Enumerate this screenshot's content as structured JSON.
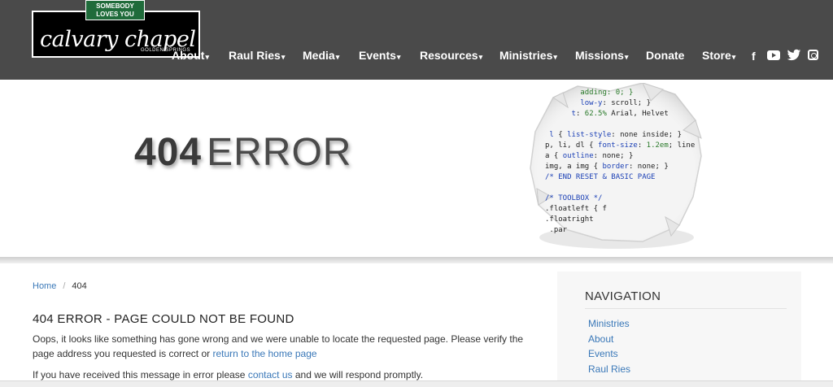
{
  "header": {
    "logo": {
      "tagline": "SOMEBODY LOVES YOU",
      "name": "calvary chapel",
      "sub": "GOLDEN SPRINGS"
    },
    "nav": [
      {
        "label": "About",
        "dropdown": true
      },
      {
        "label": "Raul Ries",
        "dropdown": true
      },
      {
        "label": "Media",
        "dropdown": true
      },
      {
        "label": "Events",
        "dropdown": true
      },
      {
        "label": "Resources",
        "dropdown": true
      },
      {
        "label": "Ministries",
        "dropdown": true
      },
      {
        "label": "Missions",
        "dropdown": true
      },
      {
        "label": "Donate",
        "dropdown": false
      },
      {
        "label": "Store",
        "dropdown": true
      }
    ],
    "social": [
      "facebook-icon",
      "youtube-icon",
      "twitter-icon",
      "instagram-icon"
    ]
  },
  "hero": {
    "title_num": "404",
    "title_word": "ERROR"
  },
  "breadcrumb": {
    "home": "Home",
    "current": "404"
  },
  "main": {
    "heading": "404 ERROR - PAGE COULD NOT BE FOUND",
    "p1_text": "Oops, it looks like something has gone wrong and we were unable to locate the requested page. Please verify the page address you requested is correct or ",
    "p1_link": "return to the home page",
    "p2_text": "If you have received this message in error please ",
    "p2_link": "contact us",
    "p2_tail": " and we will respond promptly."
  },
  "sidebar": {
    "title": "NAVIGATION",
    "links": [
      "Ministries",
      "About",
      "Events",
      "Raul Ries"
    ]
  },
  "colors": {
    "header_bg": "#4a4a4a",
    "link": "#3a78b8",
    "logo_green": "#1f6b3a"
  }
}
